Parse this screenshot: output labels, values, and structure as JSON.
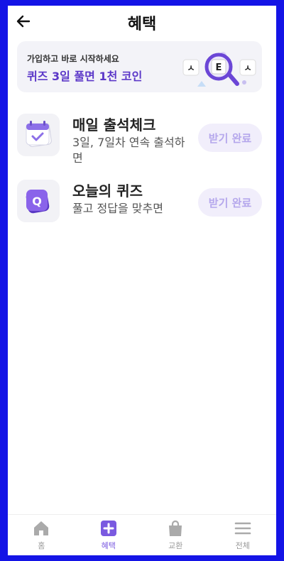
{
  "header": {
    "title": "혜택"
  },
  "banner": {
    "subtitle": "가입하고 바로 시작하세요",
    "headline": "퀴즈 3일 풀면 1천 코인",
    "tiles": [
      "ㅅ",
      "E",
      "ㅅ"
    ]
  },
  "items": [
    {
      "title": "매일 출석체크",
      "desc": "3일, 7일차 연속 출석하면",
      "button": "받기 완료",
      "icon": "calendar-check-icon"
    },
    {
      "title": "오늘의 퀴즈",
      "desc": "풀고 정답을 맞추면",
      "button": "받기 완료",
      "icon": "quiz-q-icon",
      "icon_letter": "Q"
    }
  ],
  "nav": {
    "items": [
      {
        "label": "홈",
        "icon": "home-icon"
      },
      {
        "label": "혜택",
        "icon": "plus-square-icon",
        "active": true
      },
      {
        "label": "교환",
        "icon": "shopping-bag-icon"
      },
      {
        "label": "전체",
        "icon": "menu-icon"
      }
    ]
  },
  "colors": {
    "frame": "#1414e6",
    "accent": "#7a5ae0",
    "banner_text": "#5b37c8",
    "button_bg": "#f1eefb",
    "button_text": "#b5a7ec"
  }
}
